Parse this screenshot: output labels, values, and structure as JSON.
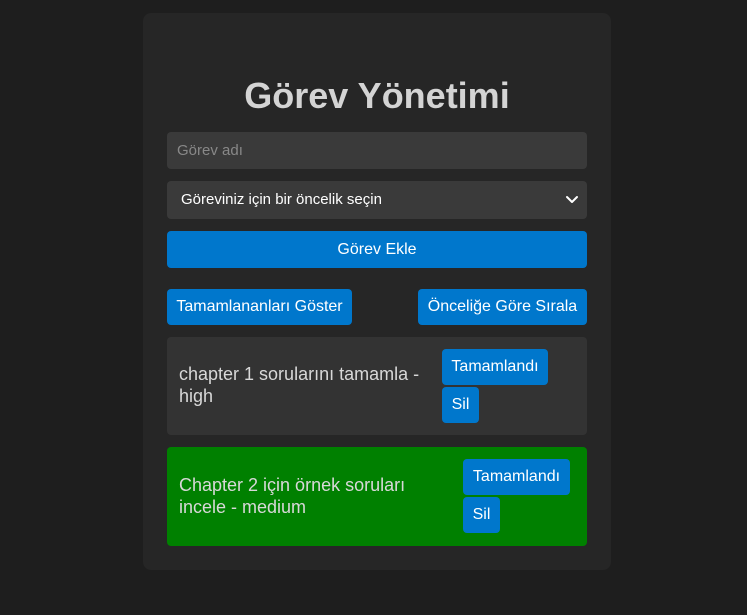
{
  "app": {
    "title": "Görev Yönetimi"
  },
  "form": {
    "task_name_placeholder": "Görev adı",
    "task_name_value": "",
    "priority_selected": "Göreviniz için bir öncelik seçin",
    "add_label": "Görev Ekle"
  },
  "toolbar": {
    "show_completed_label": "Tamamlananları Göster",
    "sort_label": "Önceliğe Göre Sırala"
  },
  "tasks": [
    {
      "text": "chapter 1 sorularını tamamla - high",
      "done_label": "Tamamlandı",
      "delete_label": "Sil",
      "background": "#333333"
    },
    {
      "text": "Chapter 2 için örnek soruları incele - medium",
      "done_label": "Tamamlandı",
      "delete_label": "Sil",
      "background": "#008000"
    }
  ],
  "colors": {
    "page_background": "#1e1e1e",
    "card_background": "#262626",
    "accent": "#0077cc",
    "completed_task": "#008000"
  }
}
